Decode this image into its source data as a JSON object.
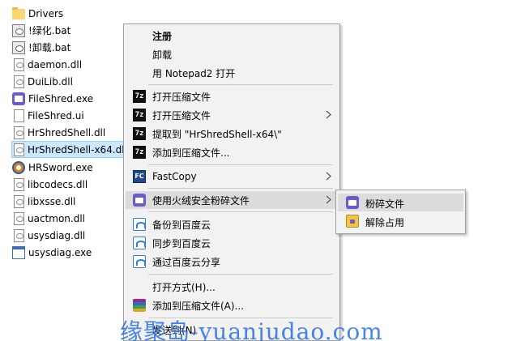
{
  "files": [
    {
      "name": "Drivers",
      "icon": "folder-icon"
    },
    {
      "name": "!绿化.bat",
      "icon": "batch-file-icon"
    },
    {
      "name": "!卸载.bat",
      "icon": "batch-file-icon"
    },
    {
      "name": "daemon.dll",
      "icon": "dll-file-icon"
    },
    {
      "name": "DuiLib.dll",
      "icon": "dll-file-icon"
    },
    {
      "name": "FileShred.exe",
      "icon": "shredder-app-icon"
    },
    {
      "name": "FileShred.ui",
      "icon": "file-icon"
    },
    {
      "name": "HrShredShell.dll",
      "icon": "dll-file-icon"
    },
    {
      "name": "HrShredShell-x64.dll",
      "icon": "dll-file-icon",
      "selected": true
    },
    {
      "name": "HRSword.exe",
      "icon": "hrsword-app-icon"
    },
    {
      "name": "libcodecs.dll",
      "icon": "dll-file-icon"
    },
    {
      "name": "libxsse.dll",
      "icon": "dll-file-icon"
    },
    {
      "name": "uactmon.dll",
      "icon": "dll-file-icon"
    },
    {
      "name": "usysdiag.dll",
      "icon": "dll-file-icon"
    },
    {
      "name": "usysdiag.exe",
      "icon": "exe-file-icon"
    }
  ],
  "context_menu": {
    "register": "注册",
    "uninstall": "卸载",
    "open_notepad2": "用 Notepad2 打开",
    "open_archive": "打开压缩文件",
    "open_archive_sub": "打开压缩文件",
    "extract_to": "提取到 \"HrShredShell-x64\\\"",
    "add_to_archive_7z": "添加到压缩文件...",
    "fastcopy": "FastCopy",
    "huorong_shred": "使用火绒安全粉碎文件",
    "backup_baidu": "备份到百度云",
    "sync_baidu": "同步到百度云",
    "share_baidu": "通过百度云分享",
    "open_with": "打开方式(H)...",
    "add_to_archive_rar": "添加到压缩文件(A)...",
    "send_to": "发送到(N)"
  },
  "submenu": {
    "shred_file": "粉碎文件",
    "unlock": "解除占用"
  },
  "watermark": "缘聚岛-yuanjudao.com"
}
